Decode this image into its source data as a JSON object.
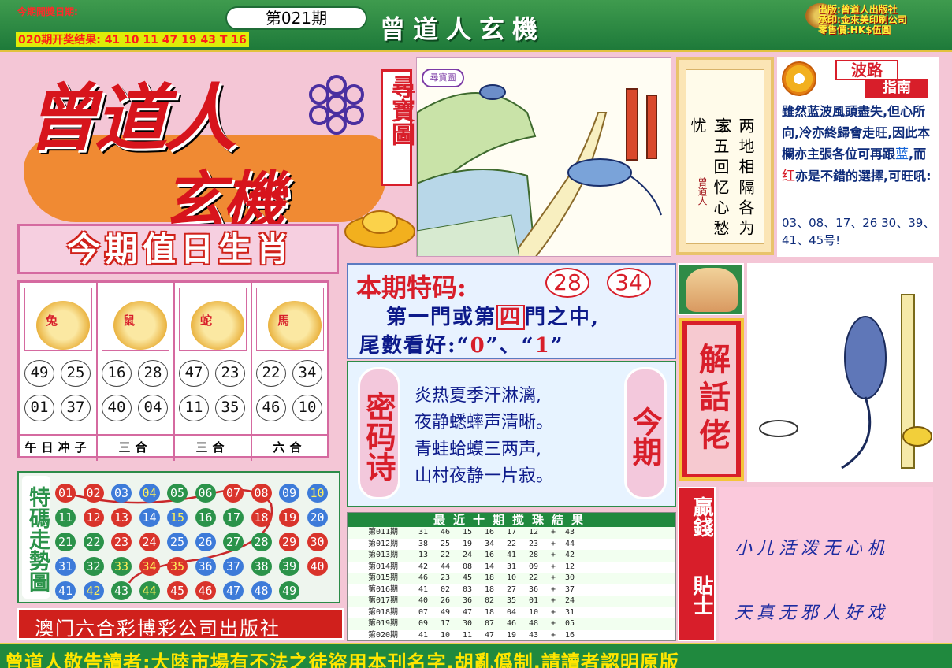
{
  "header": {
    "date_label": "今期開獎日期:",
    "last_result": "020期开奖结果: 41 10 11 47 19 43 T 16",
    "issue": "第021期",
    "title": "曾道人玄機",
    "info": [
      "出版:曾道人出版社",
      "承印:金來美印刷公司",
      "零售價:HK$伍圓"
    ]
  },
  "logo": {
    "top": "曾道人",
    "bottom": "玄機",
    "treasure_tag": "尋寶圖",
    "map_stamp": "尋寶圖"
  },
  "scroll_poem": {
    "line1": "两地相隔各为家",
    "line2": "三五回忆心愁忧",
    "seal": "曾道人"
  },
  "guide": {
    "title1": "波路",
    "title2": "指南",
    "text_a": "雖然蓝波風頭盡失,但心所向,冷亦終歸會走旺,因此本欄亦主張各位可再跟",
    "blue_word": "蓝",
    "text_b": ",而",
    "red_word": "红",
    "text_c": "亦是不錯的選擇,可旺吼:",
    "numbers": "03、08、17、26 30、39、41、45号!"
  },
  "zodiac": {
    "title": "今期值日生肖",
    "items": [
      {
        "name": "兔",
        "nums": [
          "49",
          "25",
          "01",
          "37"
        ],
        "foot": "午日冲子",
        "color": "#d81e2a"
      },
      {
        "name": "鼠",
        "nums": [
          "16",
          "28",
          "40",
          "04"
        ],
        "foot": "三合",
        "color": "#d81e2a"
      },
      {
        "name": "蛇",
        "nums": [
          "47",
          "23",
          "11",
          "35"
        ],
        "foot": "三合",
        "color": "#d81e2a"
      },
      {
        "name": "馬",
        "nums": [
          "22",
          "34",
          "46",
          "10"
        ],
        "foot": "六合",
        "color": "#d81e2a"
      }
    ]
  },
  "trend": {
    "tag": "特碼走勢圖",
    "rows": [
      [
        "01",
        "02",
        "03",
        "04",
        "05",
        "06",
        "07",
        "08",
        "09",
        "10"
      ],
      [
        "11",
        "12",
        "13",
        "14",
        "15",
        "16",
        "17",
        "18",
        "19",
        "20"
      ],
      [
        "21",
        "22",
        "23",
        "24",
        "25",
        "26",
        "27",
        "28",
        "29",
        "30"
      ],
      [
        "31",
        "32",
        "33",
        "34",
        "35",
        "36",
        "37",
        "38",
        "39",
        "40"
      ],
      [
        "41",
        "42",
        "43",
        "44",
        "45",
        "46",
        "47",
        "48",
        "49"
      ]
    ]
  },
  "publisher": "澳门六合彩博彩公司出版社",
  "special": {
    "title": "本期特码:",
    "code1": "28",
    "code2": "34",
    "line1_a": "第一門或第",
    "line1_box": "四",
    "line1_b": "門之中,",
    "line2_a": "尾數看好:“",
    "tail1": "0",
    "line2_b": "”、“",
    "tail2": "1",
    "line2_c": "”"
  },
  "cipher": {
    "tag_left": "密码诗",
    "tag_right": "今期",
    "lines": [
      "炎热夏季汗淋漓,",
      "夜静蟋蟀声清晰。",
      "青蛙蛤蟆三两声,",
      "山村夜静一片寂。"
    ]
  },
  "results": {
    "title": "最近十期搅珠結果",
    "rows": [
      {
        "issue": "第011期",
        "n": [
          "31",
          "46",
          "15",
          "16",
          "17",
          "12"
        ],
        "t": "43"
      },
      {
        "issue": "第012期",
        "n": [
          "38",
          "25",
          "19",
          "34",
          "22",
          "23"
        ],
        "t": "44"
      },
      {
        "issue": "第013期",
        "n": [
          "13",
          "22",
          "24",
          "16",
          "41",
          "28"
        ],
        "t": "42"
      },
      {
        "issue": "第014期",
        "n": [
          "42",
          "44",
          "08",
          "14",
          "31",
          "09"
        ],
        "t": "12"
      },
      {
        "issue": "第015期",
        "n": [
          "46",
          "23",
          "45",
          "18",
          "10",
          "22"
        ],
        "t": "30"
      },
      {
        "issue": "第016期",
        "n": [
          "41",
          "02",
          "03",
          "18",
          "27",
          "36"
        ],
        "t": "37"
      },
      {
        "issue": "第017期",
        "n": [
          "40",
          "26",
          "36",
          "02",
          "35",
          "01"
        ],
        "t": "24"
      },
      {
        "issue": "第018期",
        "n": [
          "07",
          "49",
          "47",
          "18",
          "04",
          "10"
        ],
        "t": "31"
      },
      {
        "issue": "第019期",
        "n": [
          "09",
          "17",
          "30",
          "07",
          "46",
          "48"
        ],
        "t": "05"
      },
      {
        "issue": "第020期",
        "n": [
          "41",
          "10",
          "11",
          "47",
          "19",
          "43"
        ],
        "t": "16"
      }
    ]
  },
  "talk": {
    "tag": "解話佬"
  },
  "tips": {
    "tag_a": "贏錢",
    "tag_b": "貼士",
    "line1": "小儿活泼无心机",
    "line2": "天真无邪人好戏"
  },
  "footer": "曾道人敬告讀者:大陸市場有不法之徒盜用本刊名字,胡亂僞制,請讀者認明原版"
}
